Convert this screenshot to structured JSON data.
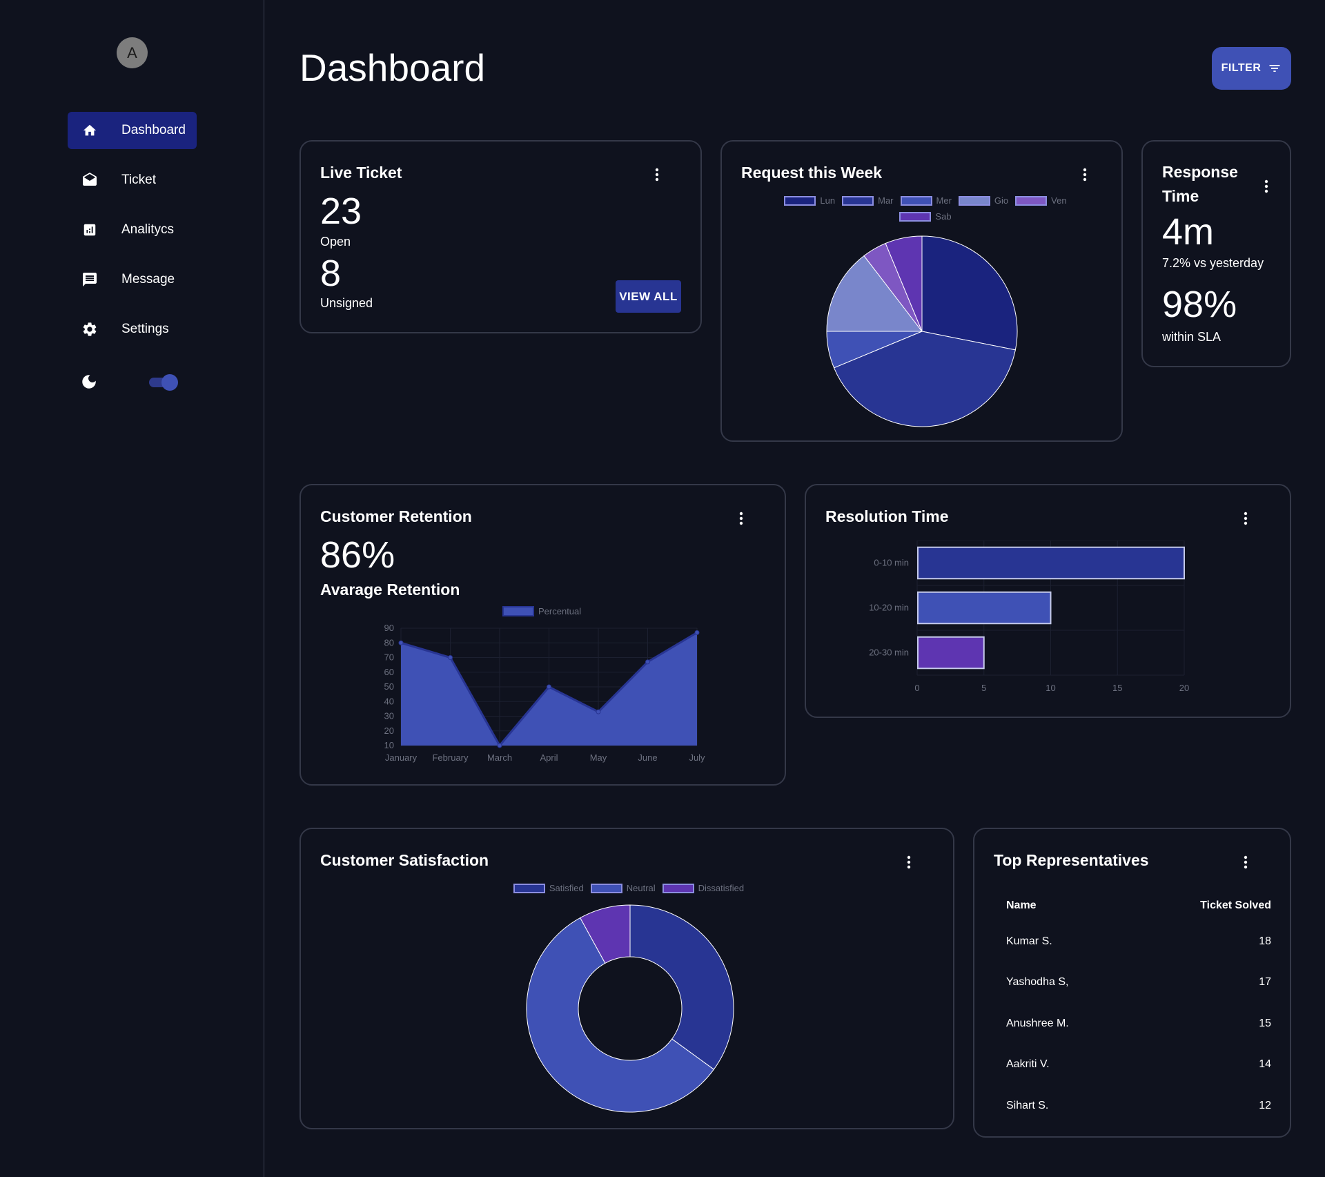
{
  "sidebar": {
    "avatar_letter": "A",
    "items": [
      {
        "label": "Dashboard",
        "icon": "home-icon",
        "active": true
      },
      {
        "label": "Ticket",
        "icon": "envelope-open-icon",
        "active": false
      },
      {
        "label": "Analitycs",
        "icon": "analytics-icon",
        "active": false
      },
      {
        "label": "Message",
        "icon": "message-icon",
        "active": false
      },
      {
        "label": "Settings",
        "icon": "gear-icon",
        "active": false
      }
    ],
    "dark_mode_icon": "moon-icon",
    "dark_mode_on": true
  },
  "header": {
    "title": "Dashboard",
    "filter_label": "FILTER"
  },
  "live_ticket": {
    "title": "Live Ticket",
    "open_count": "23",
    "open_label": "Open",
    "unsigned_count": "8",
    "unsigned_label": "Unsigned",
    "view_all_label": "VIEW ALL"
  },
  "request_week": {
    "title": "Request this Week"
  },
  "response_time": {
    "title_line1": "Response",
    "title_line2": "Time",
    "value": "4m",
    "delta": "7.2% vs yesterday",
    "sla_value": "98%",
    "sla_label": "within SLA"
  },
  "retention": {
    "title": "Customer Retention",
    "value": "86%",
    "subtitle": "Avarage Retention"
  },
  "resolution": {
    "title": "Resolution Time"
  },
  "satisfaction": {
    "title": "Customer Satisfaction"
  },
  "top_reps": {
    "title": "Top Representatives",
    "col_name": "Name",
    "col_solved": "Ticket Solved",
    "rows": [
      {
        "name": "Kumar S.",
        "solved": "18"
      },
      {
        "name": "Yashodha S,",
        "solved": "17"
      },
      {
        "name": "Anushree M.",
        "solved": "15"
      },
      {
        "name": "Aakriti V.",
        "solved": "14"
      },
      {
        "name": "Sihart S.",
        "solved": "12"
      }
    ]
  },
  "colors": {
    "background": "#0f121e",
    "card_border": "#343848",
    "primary": "#3f51b5",
    "primary_dark": "#1a237e",
    "indigo": "#283593",
    "purple": "#5e35b1"
  },
  "chart_data": [
    {
      "type": "pie",
      "categories": [
        "Lun",
        "Mar",
        "Mer",
        "Gio",
        "Ven",
        "Sab"
      ],
      "values": [
        27,
        39,
        6,
        14,
        4,
        6
      ],
      "colors": [
        "#1a237e",
        "#283593",
        "#3f51b5",
        "#7986cb",
        "#7e57c2",
        "#5e35b1"
      ]
    },
    {
      "type": "area",
      "categories": [
        "January",
        "February",
        "March",
        "April",
        "May",
        "June",
        "July"
      ],
      "series": [
        {
          "name": "Percentual",
          "values": [
            80,
            70,
            10,
            50,
            33,
            67,
            87
          ]
        }
      ],
      "ylim": [
        10,
        90
      ],
      "yticks": [
        10,
        20,
        30,
        40,
        50,
        60,
        70,
        80,
        90
      ]
    },
    {
      "type": "bar",
      "orientation": "horizontal",
      "categories": [
        "0-10 min",
        "10-20 min",
        "20-30 min"
      ],
      "values": [
        20,
        10,
        5
      ],
      "xlim": [
        0,
        20
      ],
      "xticks": [
        0,
        5,
        10,
        15,
        20
      ],
      "colors": [
        "#283593",
        "#3f51b5",
        "#5e35b1"
      ]
    },
    {
      "type": "pie",
      "categories": [
        "Satisfied",
        "Neutral",
        "Dissatisfied"
      ],
      "values": [
        35,
        57,
        8
      ],
      "colors": [
        "#283593",
        "#3f51b5",
        "#5e35b1"
      ]
    }
  ]
}
